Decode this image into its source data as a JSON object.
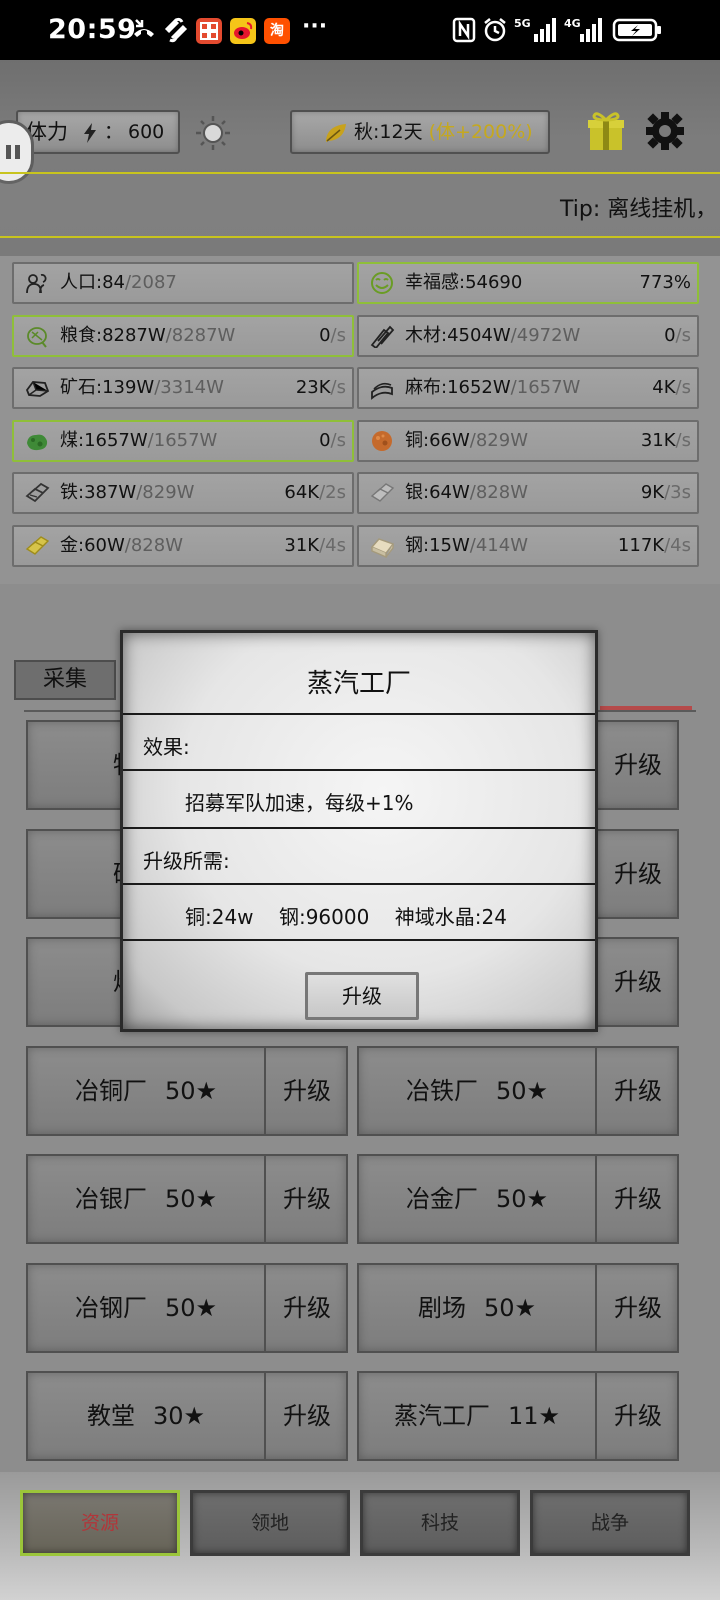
{
  "status_bar": {
    "time": "20:59",
    "app_icons": [
      "missed-call-icon",
      "link-icon",
      "xiaohongshu-app",
      "weibo-app",
      "taobao-app"
    ],
    "more": "···",
    "right_icons": [
      "nfc-icon",
      "alarm-icon",
      "5g-signal-icon",
      "4g-signal-icon",
      "battery-charging-icon"
    ],
    "taobao_glyph": "淘",
    "signal_5g": "5G",
    "signal_4g": "4G"
  },
  "top": {
    "energy_label": "体力",
    "energy_sep": "：",
    "energy_value": "600",
    "season": "秋:12天",
    "season_bonus": "(体+200%)",
    "tip": "Tip:  离线挂机，"
  },
  "resources": [
    {
      "icon": "people-icon",
      "name": "人口:84",
      "max": "/2087",
      "rate": "",
      "per": "",
      "hl": false
    },
    {
      "icon": "happy-icon",
      "name": "幸福感:54690",
      "max": "",
      "rate": "773%",
      "per": "",
      "hl": true
    },
    {
      "icon": "grain-icon",
      "name": "粮食:8287W",
      "max": "/8287W",
      "rate": "0",
      "per": "/s",
      "hl": true
    },
    {
      "icon": "wood-icon",
      "name": "木材:4504W",
      "max": "/4972W",
      "rate": "0",
      "per": "/s",
      "hl": false
    },
    {
      "icon": "ore-icon",
      "name": "矿石:139W",
      "max": "/3314W",
      "rate": "23K",
      "per": "/s",
      "hl": false
    },
    {
      "icon": "linen-icon",
      "name": "麻布:1652W",
      "max": "/1657W",
      "rate": "4K",
      "per": "/s",
      "hl": false
    },
    {
      "icon": "coal-icon",
      "name": "煤:1657W",
      "max": "/1657W",
      "rate": "0",
      "per": "/s",
      "hl": true
    },
    {
      "icon": "copper-icon",
      "name": "铜:66W",
      "max": "/829W",
      "rate": "31K",
      "per": "/s",
      "hl": false
    },
    {
      "icon": "iron-icon",
      "name": "铁:387W",
      "max": "/829W",
      "rate": "64K",
      "per": "/2s",
      "hl": false
    },
    {
      "icon": "silver-icon",
      "name": "银:64W",
      "max": "/828W",
      "rate": "9K",
      "per": "/3s",
      "hl": false
    },
    {
      "icon": "gold-icon",
      "name": "金:60W",
      "max": "/828W",
      "rate": "31K",
      "per": "/4s",
      "hl": false
    },
    {
      "icon": "steel-icon",
      "name": "钢:15W",
      "max": "/414W",
      "rate": "117K",
      "per": "/4s",
      "hl": false
    }
  ],
  "tabs": {
    "collect": "采集"
  },
  "buildings": [
    {
      "name": "牧场",
      "stars": "",
      "btn": "升级"
    },
    {
      "name": "",
      "stars": "",
      "btn": "升级"
    },
    {
      "name": "矿井",
      "stars": "",
      "btn": "升级"
    },
    {
      "name": "",
      "stars": "",
      "btn": "升级"
    },
    {
      "name": "煤井",
      "stars": "",
      "btn": "升级"
    },
    {
      "name": "",
      "stars": "",
      "btn": "升级"
    },
    {
      "name": "冶铜厂",
      "stars": "50★",
      "btn": "升级"
    },
    {
      "name": "冶铁厂",
      "stars": "50★",
      "btn": "升级"
    },
    {
      "name": "冶银厂",
      "stars": "50★",
      "btn": "升级"
    },
    {
      "name": "冶金厂",
      "stars": "50★",
      "btn": "升级"
    },
    {
      "name": "冶钢厂",
      "stars": "50★",
      "btn": "升级"
    },
    {
      "name": "剧场",
      "stars": "50★",
      "btn": "升级"
    },
    {
      "name": "教堂",
      "stars": "30★",
      "btn": "升级"
    },
    {
      "name": "蒸汽工厂",
      "stars": "11★",
      "btn": "升级"
    }
  ],
  "modal": {
    "title": "蒸汽工厂",
    "effect_label": "效果:",
    "effect_text": "招募军队加速，每级+1%",
    "cost_label": "升级所需:",
    "cost_text": "铜:24w    钢:96000    神域水晶:24",
    "button": "升级"
  },
  "nav": [
    {
      "label": "资源",
      "active": true
    },
    {
      "label": "领地",
      "active": false
    },
    {
      "label": "科技",
      "active": false
    },
    {
      "label": "战争",
      "active": false
    }
  ]
}
